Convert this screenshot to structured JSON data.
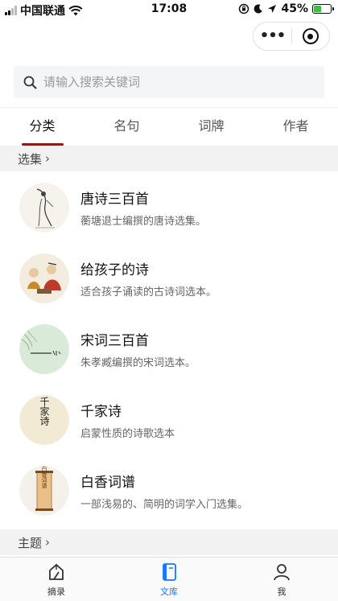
{
  "status_bar": {
    "carrier": "中国联通",
    "time": "17:08",
    "battery": "45%",
    "battery_level": 0.45
  },
  "search": {
    "placeholder": "请输入搜索关键词"
  },
  "tabs": [
    {
      "label": "分类",
      "active": true
    },
    {
      "label": "名句",
      "active": false
    },
    {
      "label": "词牌",
      "active": false
    },
    {
      "label": "作者",
      "active": false
    }
  ],
  "sections": [
    {
      "title": "选集"
    },
    {
      "title": "主题"
    }
  ],
  "items": [
    {
      "title": "唐诗三百首",
      "desc": "蘅塘退士编撰的唐诗选集。"
    },
    {
      "title": "给孩子的诗",
      "desc": "适合孩子诵读的古诗词选本。"
    },
    {
      "title": "宋词三百首",
      "desc": "朱孝臧编撰的宋词选本。"
    },
    {
      "title": "千家诗",
      "desc": "启蒙性质的诗歌选本"
    },
    {
      "title": "白香词谱",
      "desc": "一部浅易的、简明的词学入门选集。"
    }
  ],
  "thumb_text": {
    "qianjia": "千家诗",
    "baixiang": "白香词谱"
  },
  "nav": [
    {
      "label": "摘录",
      "active": false
    },
    {
      "label": "文库",
      "active": true
    },
    {
      "label": "我",
      "active": false
    }
  ],
  "colors": {
    "accent_tab": "#8b1a1a",
    "nav_active": "#1677ff"
  }
}
